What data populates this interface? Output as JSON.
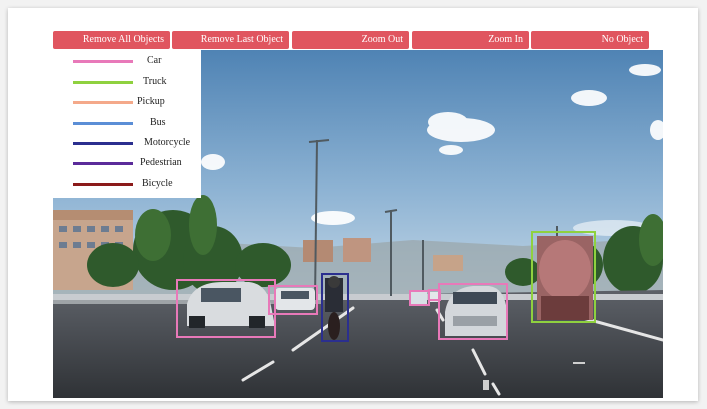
{
  "toolbar": {
    "buttons": [
      {
        "label": "Remove All Objects"
      },
      {
        "label": "Remove Last Object"
      },
      {
        "label": "Zoom Out"
      },
      {
        "label": "Zoom In"
      },
      {
        "label": "No Object"
      }
    ],
    "button_color": "#e0555f"
  },
  "legend": {
    "items": [
      {
        "label": "Car",
        "color": "#e879b9"
      },
      {
        "label": "Truck",
        "color": "#8fd13f"
      },
      {
        "label": "Pickup",
        "color": "#f4a98a"
      },
      {
        "label": "Bus",
        "color": "#5b8ed6"
      },
      {
        "label": "Motorcycle",
        "color": "#2b2f8f"
      },
      {
        "label": "Pedestrian",
        "color": "#5b2b9a"
      },
      {
        "label": "Bicycle",
        "color": "#8b1a1a"
      }
    ]
  },
  "annotations": [
    {
      "class": "Car",
      "color": "#e879b9"
    },
    {
      "class": "Car",
      "color": "#e879b9"
    },
    {
      "class": "Motorcycle",
      "color": "#2b2f8f"
    },
    {
      "class": "Car",
      "color": "#e879b9"
    },
    {
      "class": "Car",
      "color": "#e879b9"
    },
    {
      "class": "Car",
      "color": "#e879b9"
    },
    {
      "class": "Truck",
      "color": "#8fd13f"
    }
  ]
}
